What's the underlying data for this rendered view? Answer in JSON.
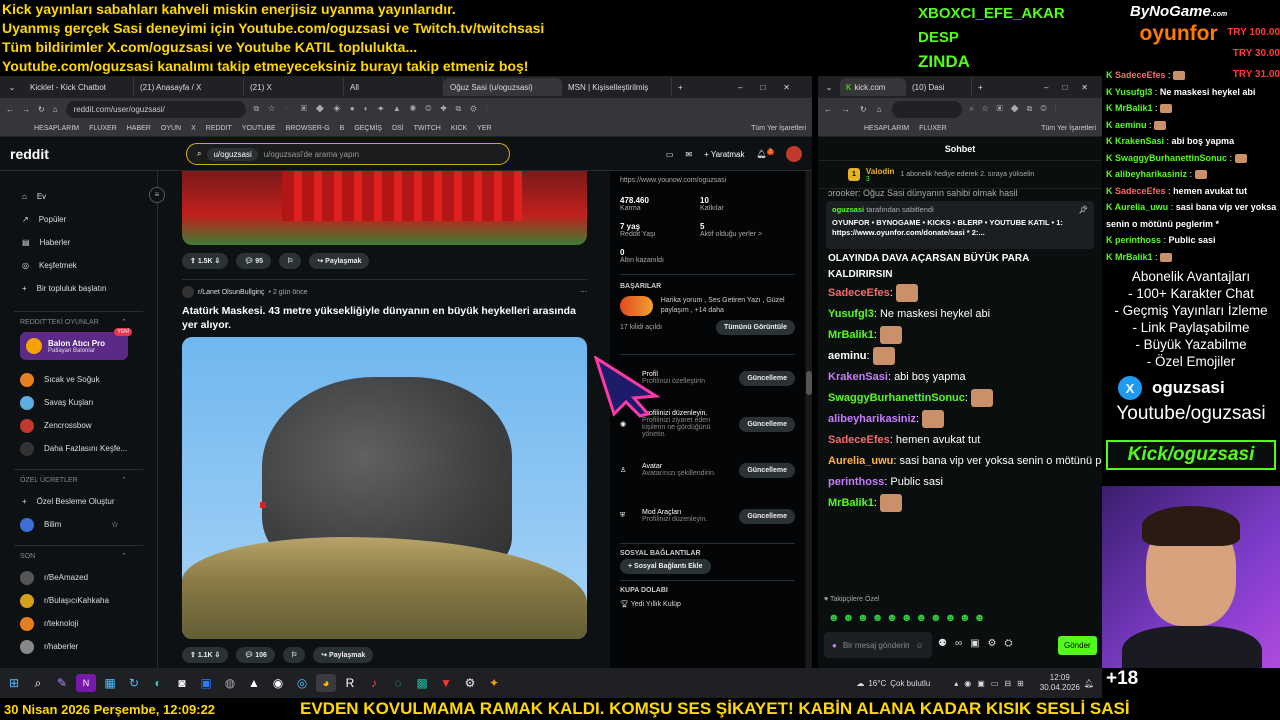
{
  "overlay": {
    "lines": [
      "Kick yayınları sabahları kahveli miskin enerjisiz uyanma yayınlarıdır.",
      "Uyanmış gerçek Sasi deneyimi için Youtube.com/oguzsasi ve Twitch.tv/twitchsasi",
      "Tüm bildirimler X.com/oguzsasi ve Youtube KATIL toplulukta...",
      "Youtube.com/oguzsasi kanalımı takip etmeyeceksiniz burayı takip etmeniz boş!"
    ],
    "names": [
      "XBOXCI_EFE_AKAR",
      "DESP",
      "ZINDA"
    ],
    "logo_top": "ByNoGame",
    "logo_com": ".com",
    "logo_bottom": "oyunfor",
    "donations": [
      "TRY 100.00",
      "TRY 30.00",
      "TRY 31.00"
    ]
  },
  "left_browser": {
    "tabs": [
      "Kicklet - Kick Chatbot",
      "(21) Anasayfa / X",
      "(21) X",
      "All",
      "Oğuz Sasi (u/oguzsasi)",
      "MSN | Kişiselleştirilmiş"
    ],
    "url": "reddit.com/user/oguzsasi/",
    "bookmarks": [
      "HESAPLARIM",
      "FLUXER",
      "HABER",
      "OYUN",
      "X",
      "REDDIT",
      "YOUTUBE",
      "BROWSER-G",
      "B",
      "GEÇMİŞ",
      "DSİ",
      "TWITCH",
      "KICK",
      "YER",
      "Tüm Yer İşaretleri"
    ]
  },
  "reddit": {
    "logo": "reddit",
    "search_chip": "u/oguzsasi",
    "search_placeholder": "u/oguzsasi'de arama yapın",
    "create": "Yaratmak",
    "notif_count": "2",
    "nav": [
      "Ev",
      "Popüler",
      "Haberler",
      "Keşfetmek",
      "Bir topluluk başlatın"
    ],
    "games_header": "REDDIT'TEKİ OYUNLAR",
    "game_title": "Balon Atıcı Pro",
    "game_sub": "Patlayan Balonlar",
    "game_badge": "YENİ",
    "games": [
      "Sıcak ve Soğuk",
      "Savaş Kuşları",
      "Zencrossbow",
      "Daha Fazlasını Keşfe..."
    ],
    "custom_header": "ÖZEL ÜCRETLER",
    "custom": [
      "Özel Besleme Oluştur",
      "Bilim"
    ],
    "recent_header": "SON",
    "recent": [
      "r/BeAmazed",
      "r/BulaşıcıKahkaha",
      "r/teknoloji",
      "r/haberler"
    ],
    "post1": {
      "votes": "1.5K",
      "comments": "95",
      "share": "Paylaşmak"
    },
    "post2": {
      "sub": "r/Lanet OlsunBullginç",
      "time": "• 2 gün önce",
      "title": "Atatürk Maskesi. 43 metre yüksekliğiyle dünyanın en büyük heykelleri arasında yer alıyor.",
      "votes": "1.1K",
      "comments": "106",
      "share": "Paylaşmak"
    },
    "side": {
      "link": "https://www.younow.com/oguzsasi",
      "karma": "478.460",
      "karma_l": "Karma",
      "katki": "10",
      "katki_l": "Katkılar",
      "age": "7 yaş",
      "age_l": "Reddit Yaşı",
      "active": "5",
      "active_l": "Aktif olduğu yerler >",
      "gold": "0",
      "gold_l": "Altın kazanıldı",
      "ach_header": "BAŞARILAR",
      "ach_text": "Harika yorum , Ses Getiren Yazı , Güzel paylaşım , +14 daha",
      "ach_count": "17 kilidi açıldı",
      "ach_btn": "Tümünü Görüntüle",
      "rows": [
        {
          "t": "Profil",
          "s": "Profilinizi özelleştirin",
          "b": "Güncelleme"
        },
        {
          "t": "Profilinizi düzenleyin.",
          "s": "Profilinizi ziyaret eden kişilerin ne gördüğünü yönetin.",
          "b": "Güncelleme"
        },
        {
          "t": "Avatar",
          "s": "Avatarınızı şekillendirin.",
          "b": "Güncelleme"
        },
        {
          "t": "Mod Araçları",
          "s": "Profilinizi düzenleyin.",
          "b": "Güncelleme"
        }
      ],
      "social_header": "SOSYAL BAĞLANTILAR",
      "social_btn": "+ Sosyal Bağlantı Ekle",
      "kupa": "KUPA DOLABI",
      "kupa_item": "Yedi Yıllık Kulüp"
    }
  },
  "right_browser": {
    "tabs": [
      "kick.com",
      "(10) Dasi"
    ],
    "bookmarks": [
      "HESAPLARIM",
      "FLUXER",
      "Tüm Yer İşaretleri"
    ],
    "chat_title": "Sohbet",
    "sub_user": "Valodin",
    "sub_level": "1",
    "sub_num": "3",
    "sub_msg": "1 abonelik hediye ederek 2. sıraya yükselin",
    "partial": "ɔrooker: Oğuz Sasi dünyanın sahibi olmak hasil",
    "pinned_by": "oguzsasi",
    "pinned_text": "tarafından sabitlendi",
    "pinned_body": "OYUNFOR • BYNOGAME • KICKS • BLERP • YOUTUBE KATIL • 1: https://www.oyunfor.com/donate/sasi * 2:...",
    "partial2": "OLAYINDA DAVA AÇARSAN BÜYÜK PARA KALDIRIRSIN",
    "messages": [
      {
        "u": "SadeceEfes",
        "c": "#f56b6b",
        "t": ""
      },
      {
        "u": "Yusufgl3",
        "c": "#53fc18",
        "t": "Ne maskesi heykel abi"
      },
      {
        "u": "MrBalik1",
        "c": "#53fc18",
        "t": ""
      },
      {
        "u": "aeminu",
        "c": "#fff",
        "t": ""
      },
      {
        "u": "KrakenSasi",
        "c": "#c77dff",
        "t": "abi boş yapma"
      },
      {
        "u": "SwaggyBurhanettinSonuc",
        "c": "#53fc18",
        "t": ""
      },
      {
        "u": "alibeyharikasiniz",
        "c": "#c77dff",
        "t": ""
      },
      {
        "u": "SadeceEfes",
        "c": "#f56b6b",
        "t": "hemen avukat tut"
      },
      {
        "u": "Aurelia_uwu",
        "c": "#ffb347",
        "t": "sasi bana vip ver yoksa senin o mötünü peglerim *"
      },
      {
        "u": "perinthoss",
        "c": "#c77dff",
        "t": "Public sasi"
      },
      {
        "u": "MrBalik1",
        "c": "#53fc18",
        "t": ""
      }
    ],
    "followers": "Takipçilere Özel",
    "input_placeholder": "Bir mesaj gönderin",
    "send": "Gönder"
  },
  "mini_chat": [
    {
      "u": "SadeceEfes",
      "c": "#f56b6b",
      "t": ""
    },
    {
      "u": "Yusufgl3",
      "c": "#53fc18",
      "t": "Ne maskesi heykel abi"
    },
    {
      "u": "MrBalik1",
      "c": "#53fc18",
      "t": ""
    },
    {
      "u": "aeminu",
      "c": "#53fc18",
      "t": ""
    },
    {
      "u": "KrakenSasi",
      "c": "#53fc18",
      "t": "abi boş yapma"
    },
    {
      "u": "SwaggyBurhanettinSonuc",
      "c": "#53fc18",
      "t": ""
    },
    {
      "u": "alibeyharikasiniz",
      "c": "#53fc18",
      "t": ""
    },
    {
      "u": "SadeceEfes",
      "c": "#f56b6b",
      "t": "hemen avukat tut"
    },
    {
      "u": "Aurelia_uwu",
      "c": "#53fc18",
      "t": "sasi bana vip ver yoksa senin o mötünü peglerim *"
    },
    {
      "u": "perinthoss",
      "c": "#53fc18",
      "t": "Public sasi"
    },
    {
      "u": "MrBalik1",
      "c": "#53fc18",
      "t": ""
    }
  ],
  "perks": {
    "title": "Abonelik Avantajları",
    "items": [
      "- 100+ Karakter Chat",
      "- Geçmiş Yayınları İzleme",
      "- Link Paylaşabilme",
      "- Büyük Yazabilme",
      "- Özel Emojiler"
    ],
    "x_handle": "oguzsasi",
    "youtube": "Youtube/oguzsasi",
    "kick": "Kick/oguzsasi",
    "plus": "+18"
  },
  "taskbar": {
    "temp": "16°C",
    "weather": "Çok bulutlu",
    "time": "12:09",
    "date": "30.04.2026"
  },
  "bottom": {
    "datetime": "30 Nisan 2026 Perşembe, 12:09:22",
    "ticker": "EVDEN KOVULMAMA RAMAK KALDI. KOMŞU SES ŞİKAYET! KABİN ALANA KADAR KISIK SESLİ SASİ"
  }
}
